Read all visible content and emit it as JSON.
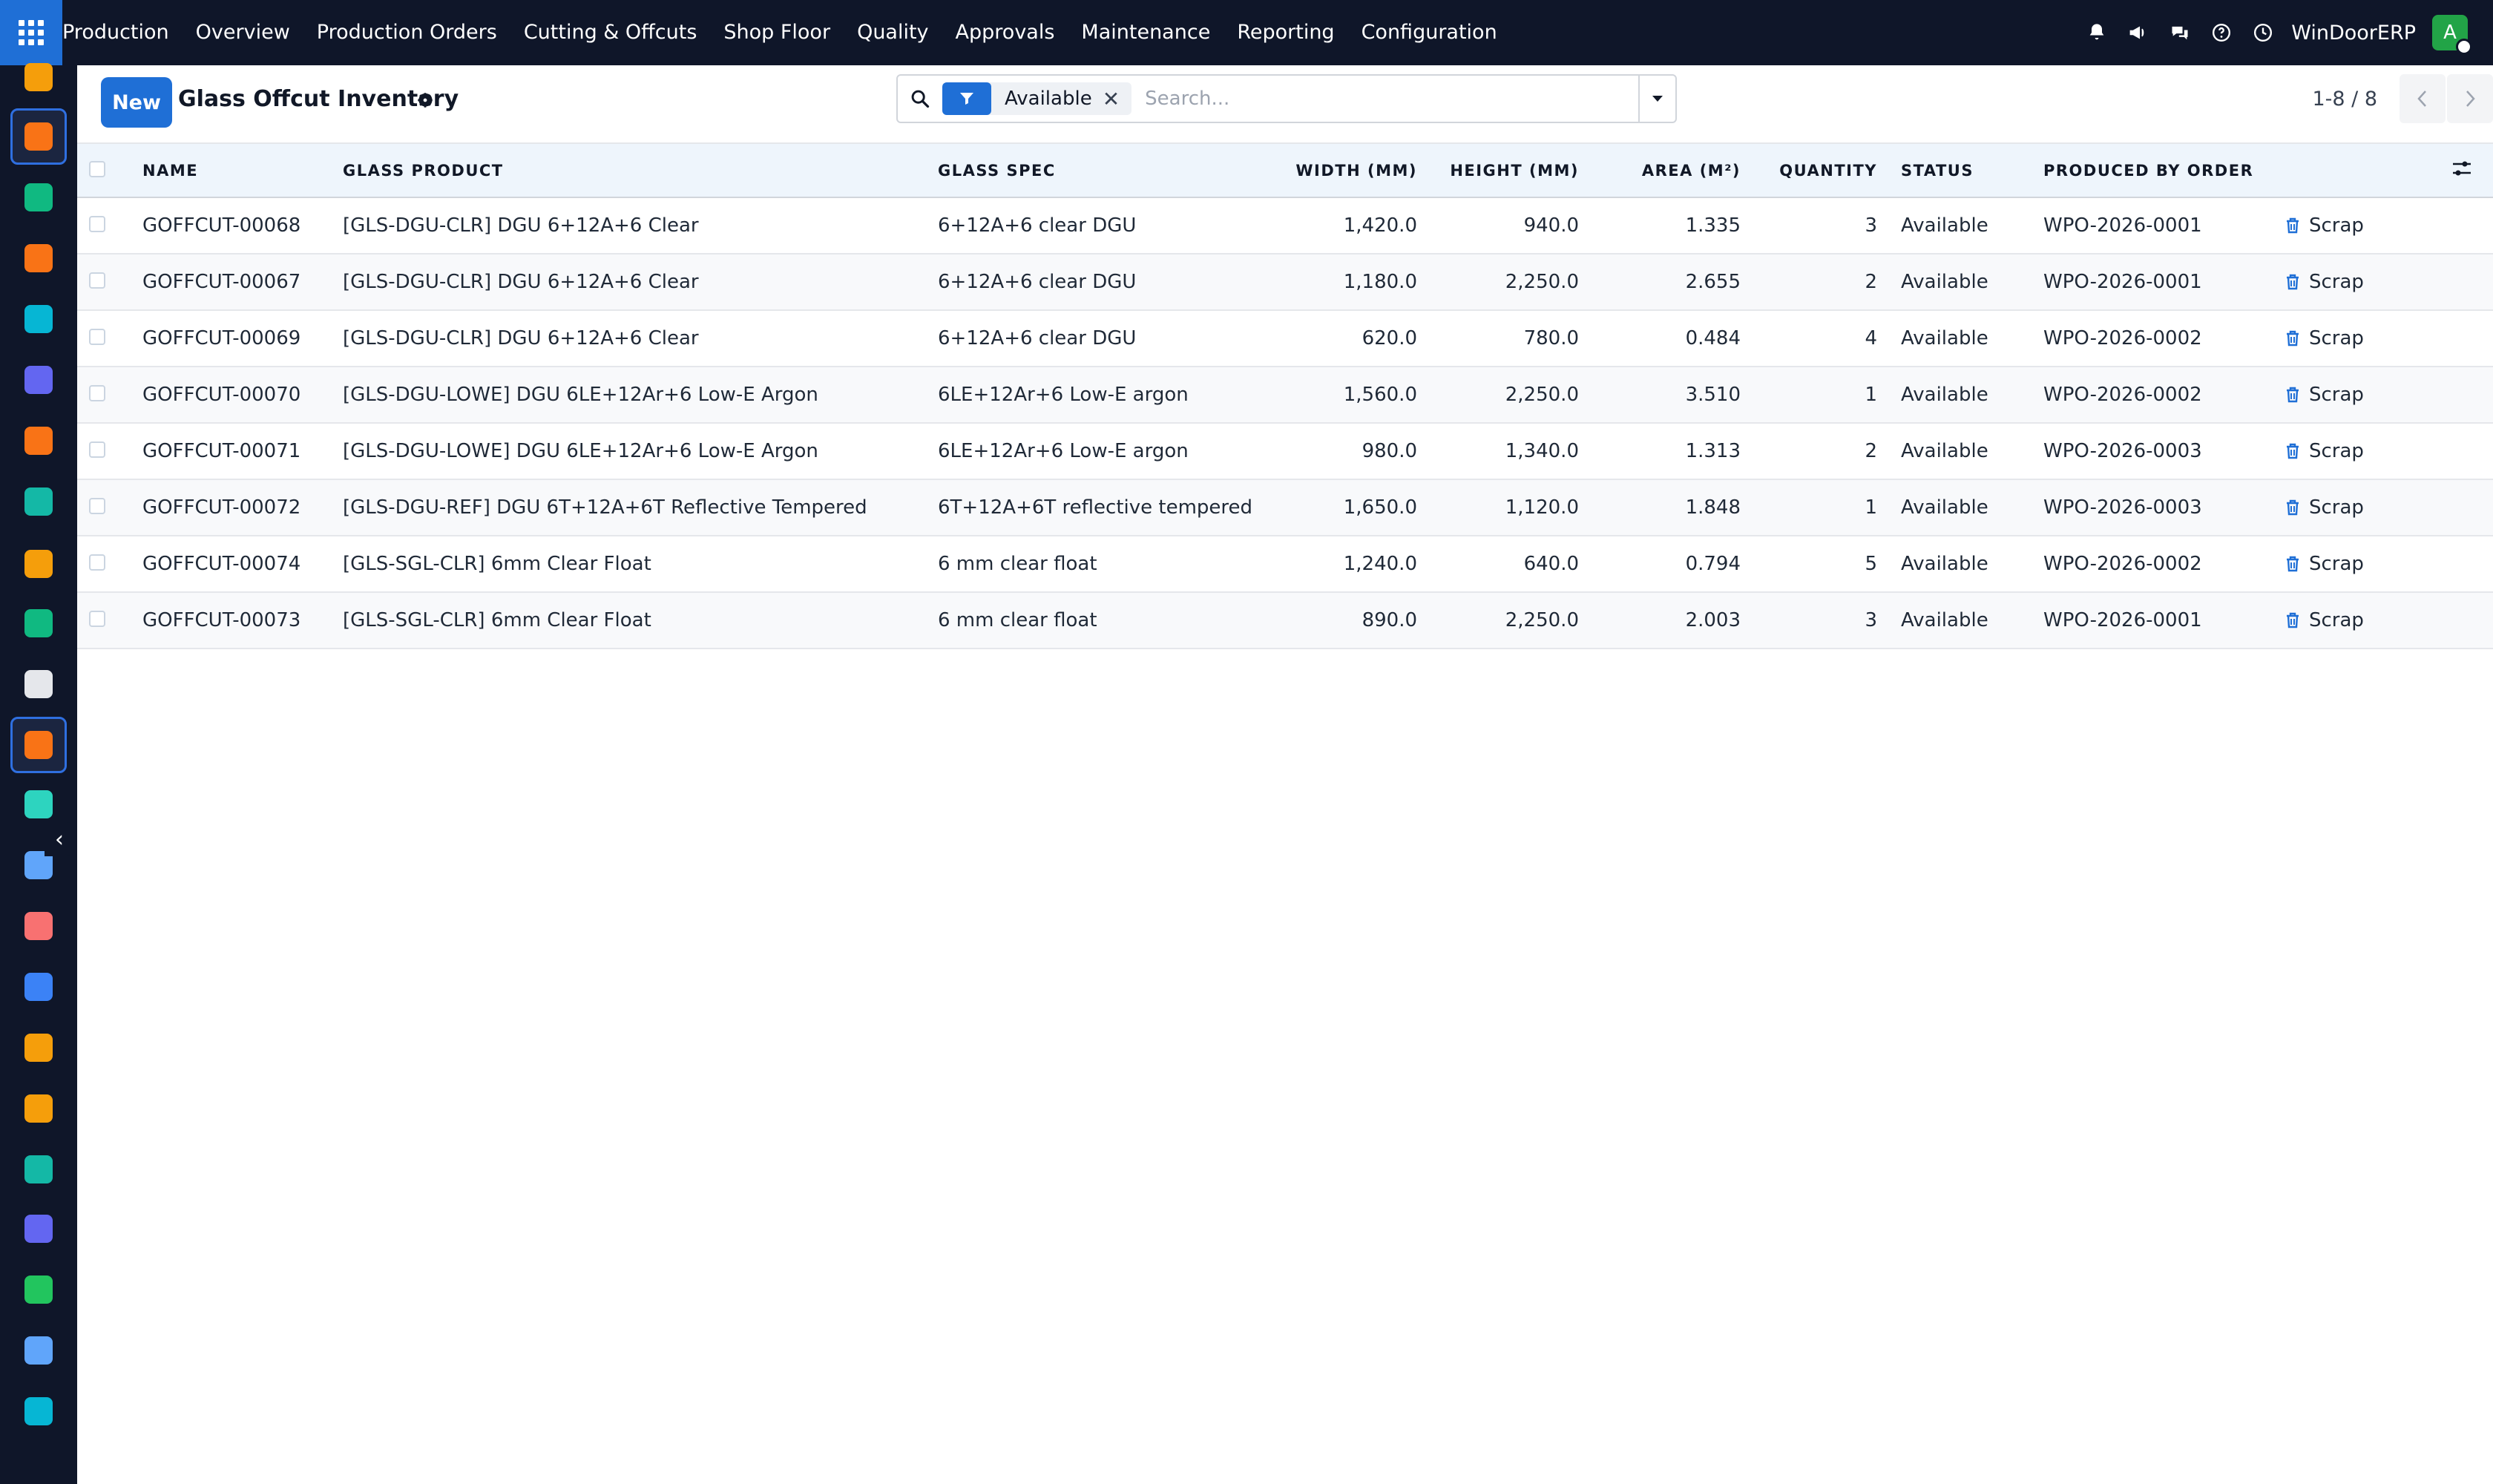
{
  "topbar": {
    "app_name": "Production",
    "menu": [
      "Overview",
      "Production Orders",
      "Cutting & Offcuts",
      "Shop Floor",
      "Quality",
      "Approvals",
      "Maintenance",
      "Reporting",
      "Configuration"
    ],
    "company": "WinDoorERP",
    "avatar_initial": "A"
  },
  "rail": {
    "items": [
      {
        "icon": "reporting-icon",
        "color": "#f59e0b"
      },
      {
        "icon": "manufacturing-icon",
        "color": "#f97316",
        "active": true
      },
      {
        "icon": "contacts-icon",
        "color": "#10b981"
      },
      {
        "icon": "discuss-icon",
        "color": "#f97316"
      },
      {
        "icon": "website-icon",
        "color": "#06b6d4"
      },
      {
        "icon": "mail-icon",
        "color": "#6366f1"
      },
      {
        "icon": "chat-icon",
        "color": "#f97316"
      },
      {
        "icon": "sales-icon",
        "color": "#14b8a6"
      },
      {
        "icon": "analytics-icon",
        "color": "#f59e0b"
      },
      {
        "icon": "employees-icon",
        "color": "#10b981"
      },
      {
        "icon": "inventory-icon",
        "color": "#e5e7eb"
      },
      {
        "icon": "mrp-icon",
        "color": "#f97316",
        "active": true
      },
      {
        "icon": "quality-icon",
        "color": "#2dd4bf"
      },
      {
        "icon": "knowledge-icon",
        "color": "#60a5fa"
      },
      {
        "icon": "products-icon",
        "color": "#f87171"
      },
      {
        "icon": "invoicing-icon",
        "color": "#3b82f6"
      },
      {
        "icon": "team-icon",
        "color": "#f59e0b"
      },
      {
        "icon": "calendar-icon",
        "color": "#f59e0b"
      },
      {
        "icon": "sign-icon",
        "color": "#14b8a6"
      },
      {
        "icon": "dashboard-icon",
        "color": "#6366f1"
      },
      {
        "icon": "whatsapp-icon",
        "color": "#22c55e"
      },
      {
        "icon": "timer-icon",
        "color": "#60a5fa"
      },
      {
        "icon": "link-icon",
        "color": "#06b6d4"
      }
    ]
  },
  "control": {
    "new_label": "New",
    "title": "Glass Offcut Inventory",
    "facet_label": "Available",
    "search_placeholder": "Search...",
    "pager": "1-8 / 8"
  },
  "table": {
    "headers": {
      "name": "NAME",
      "product": "GLASS PRODUCT",
      "spec": "GLASS SPEC",
      "width": "WIDTH (MM)",
      "height": "HEIGHT (MM)",
      "area": "AREA (M²)",
      "qty": "QUANTITY",
      "status": "STATUS",
      "order": "PRODUCED BY ORDER"
    },
    "action_label": "Scrap",
    "rows": [
      {
        "name": "GOFFCUT-00068",
        "product": "[GLS-DGU-CLR] DGU 6+12A+6 Clear",
        "spec": "6+12A+6 clear DGU",
        "width": "1,420.0",
        "height": "940.0",
        "area": "1.335",
        "qty": "3",
        "status": "Available",
        "order": "WPO-2026-0001"
      },
      {
        "name": "GOFFCUT-00067",
        "product": "[GLS-DGU-CLR] DGU 6+12A+6 Clear",
        "spec": "6+12A+6 clear DGU",
        "width": "1,180.0",
        "height": "2,250.0",
        "area": "2.655",
        "qty": "2",
        "status": "Available",
        "order": "WPO-2026-0001"
      },
      {
        "name": "GOFFCUT-00069",
        "product": "[GLS-DGU-CLR] DGU 6+12A+6 Clear",
        "spec": "6+12A+6 clear DGU",
        "width": "620.0",
        "height": "780.0",
        "area": "0.484",
        "qty": "4",
        "status": "Available",
        "order": "WPO-2026-0002"
      },
      {
        "name": "GOFFCUT-00070",
        "product": "[GLS-DGU-LOWE] DGU 6LE+12Ar+6 Low-E Argon",
        "spec": "6LE+12Ar+6 Low-E argon",
        "width": "1,560.0",
        "height": "2,250.0",
        "area": "3.510",
        "qty": "1",
        "status": "Available",
        "order": "WPO-2026-0002"
      },
      {
        "name": "GOFFCUT-00071",
        "product": "[GLS-DGU-LOWE] DGU 6LE+12Ar+6 Low-E Argon",
        "spec": "6LE+12Ar+6 Low-E argon",
        "width": "980.0",
        "height": "1,340.0",
        "area": "1.313",
        "qty": "2",
        "status": "Available",
        "order": "WPO-2026-0003"
      },
      {
        "name": "GOFFCUT-00072",
        "product": "[GLS-DGU-REF] DGU 6T+12A+6T Reflective Tempered",
        "spec": "6T+12A+6T reflective tempered",
        "width": "1,650.0",
        "height": "1,120.0",
        "area": "1.848",
        "qty": "1",
        "status": "Available",
        "order": "WPO-2026-0003"
      },
      {
        "name": "GOFFCUT-00074",
        "product": "[GLS-SGL-CLR] 6mm Clear Float",
        "spec": "6 mm clear float",
        "width": "1,240.0",
        "height": "640.0",
        "area": "0.794",
        "qty": "5",
        "status": "Available",
        "order": "WPO-2026-0002"
      },
      {
        "name": "GOFFCUT-00073",
        "product": "[GLS-SGL-CLR] 6mm Clear Float",
        "spec": "6 mm clear float",
        "width": "890.0",
        "height": "2,250.0",
        "area": "2.003",
        "qty": "3",
        "status": "Available",
        "order": "WPO-2026-0001"
      }
    ]
  },
  "colors": {
    "navbar": "#0f1629",
    "primary": "#1f6fd6",
    "header_bg": "#eef5fc",
    "avatar": "#22a447"
  }
}
